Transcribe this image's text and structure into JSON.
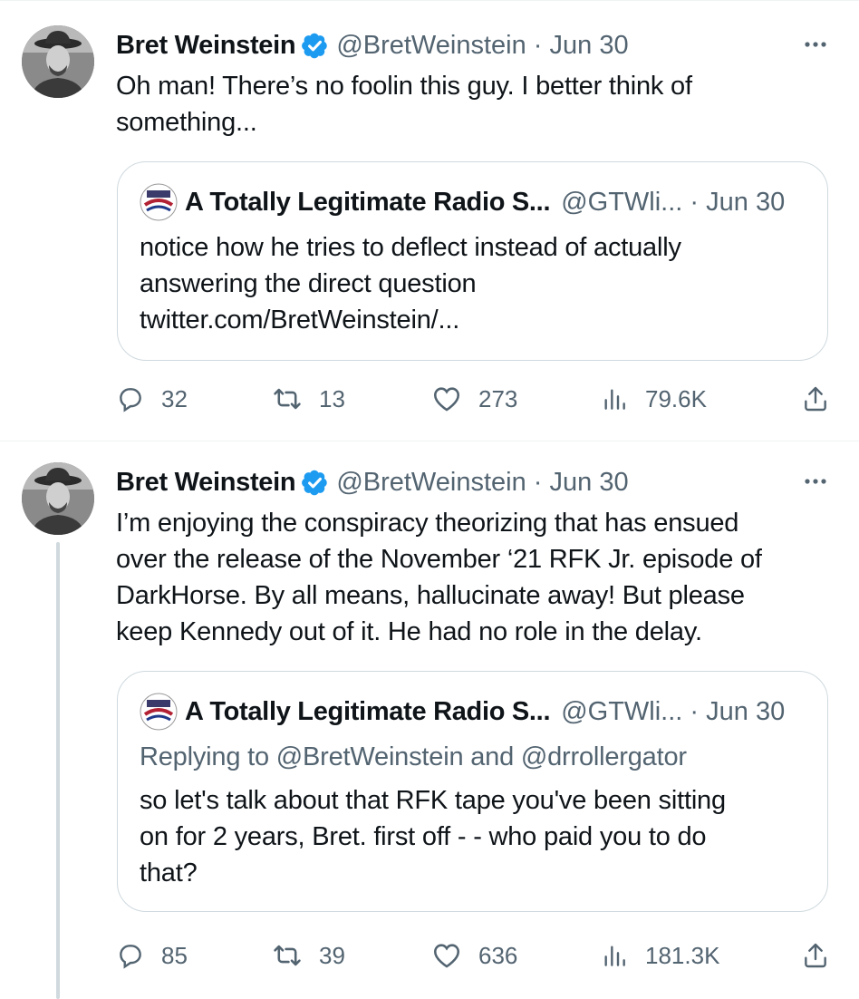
{
  "tweets": [
    {
      "author": {
        "name": "Bret Weinstein",
        "handle": "@BretWeinstein",
        "verified": true
      },
      "date_sep": " · ",
      "date": "Jun 30",
      "text": "Oh man! There’s no foolin this guy. I better think of\nsomething...",
      "quote": {
        "author": {
          "name": "A Totally Legitimate Radio S...",
          "handle": "@GTWli..."
        },
        "date_sep": " · ",
        "date": "Jun 30",
        "replying_to": "",
        "text": "notice how he tries to deflect instead of actually\nanswering the direct question\ntwitter.com/BretWeinstein/..."
      },
      "actions": {
        "replies": "32",
        "retweets": "13",
        "likes": "273",
        "views": "79.6K"
      }
    },
    {
      "author": {
        "name": "Bret Weinstein",
        "handle": "@BretWeinstein",
        "verified": true
      },
      "date_sep": " · ",
      "date": "Jun 30",
      "text": "I’m enjoying the conspiracy theorizing that has ensued\nover the release of the November ‘21 RFK Jr. episode of\nDarkHorse. By all means, hallucinate away! But please\nkeep Kennedy out of it. He had no role in the delay.",
      "quote": {
        "author": {
          "name": "A Totally Legitimate Radio S...",
          "handle": "@GTWli..."
        },
        "date_sep": " · ",
        "date": "Jun 30",
        "replying_to": "Replying to @BretWeinstein and @drrollergator",
        "text": "so let's talk about that RFK tape you've been sitting\non for 2 years, Bret. first off - - who paid you to do\nthat?"
      },
      "actions": {
        "replies": "85",
        "retweets": "39",
        "likes": "636",
        "views": "181.3K"
      }
    }
  ],
  "icons": {
    "verified": "verified-badge-icon",
    "more": "more-dots-icon",
    "reply": "reply-bubble-icon",
    "retweet": "retweet-arrows-icon",
    "like": "heart-icon",
    "views": "bar-chart-icon",
    "share": "share-upload-icon"
  },
  "colors": {
    "verified": "#1d9bf0",
    "muted": "#536471",
    "border": "#cfd9de",
    "text": "#0f1419"
  }
}
